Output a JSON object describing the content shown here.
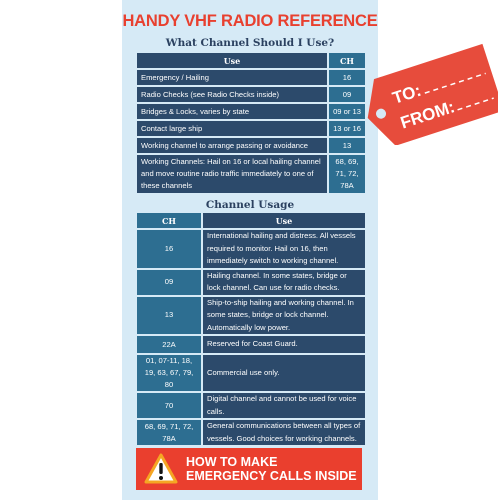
{
  "title": "HANDY VHF RADIO REFERENCE",
  "section1": {
    "heading": "What Channel Should I Use?",
    "headers": {
      "use": "Use",
      "ch": "CH"
    },
    "rows": [
      {
        "use": "Emergency / Hailing",
        "ch": "16"
      },
      {
        "use": "Radio Checks (see Radio Checks inside)",
        "ch": "09"
      },
      {
        "use": "Bridges & Locks, varies by state",
        "ch": "09 or 13"
      },
      {
        "use": "Contact large ship",
        "ch": "13 or 16"
      },
      {
        "use": "Working channel to arrange passing or avoidance",
        "ch": "13"
      },
      {
        "use": "Working Channels: Hail on 16 or local hailing channel and move routine radio traffic immediately to one of these channels",
        "ch": "68, 69, 71, 72, 78A"
      }
    ]
  },
  "section2": {
    "heading": "Channel Usage",
    "headers": {
      "ch": "CH",
      "use": "Use"
    },
    "rows": [
      {
        "ch": "16",
        "use": "International hailing and distress. All vessels required to monitor. Hail on 16, then immediately switch to working channel."
      },
      {
        "ch": "09",
        "use": "Hailing channel. In some states, bridge or lock channel. Can use for radio checks."
      },
      {
        "ch": "13",
        "use": "Ship-to-ship hailing and working channel. In some states, bridge or lock channel. Automatically low power."
      },
      {
        "ch": "22A",
        "use": "Reserved for Coast Guard."
      },
      {
        "ch": "01, 07-11, 18, 19, 63, 67, 79, 80",
        "use": "Commercial use only."
      },
      {
        "ch": "70",
        "use": "Digital channel and cannot be used for voice calls."
      },
      {
        "ch": "68, 69, 71, 72, 78A",
        "use": "General communications between all types of vessels. Good choices for working channels."
      }
    ]
  },
  "banner": {
    "line1": "HOW TO MAKE",
    "line2": "EMERGENCY CALLS INSIDE",
    "icon": "warning-icon"
  },
  "tag": {
    "to": "TO:",
    "from": "FROM:"
  },
  "colors": {
    "accent": "#e8402f",
    "panel": "#d6eaf6",
    "dark_cell": "#2c4a6b",
    "mid_cell": "#2d6e91"
  }
}
